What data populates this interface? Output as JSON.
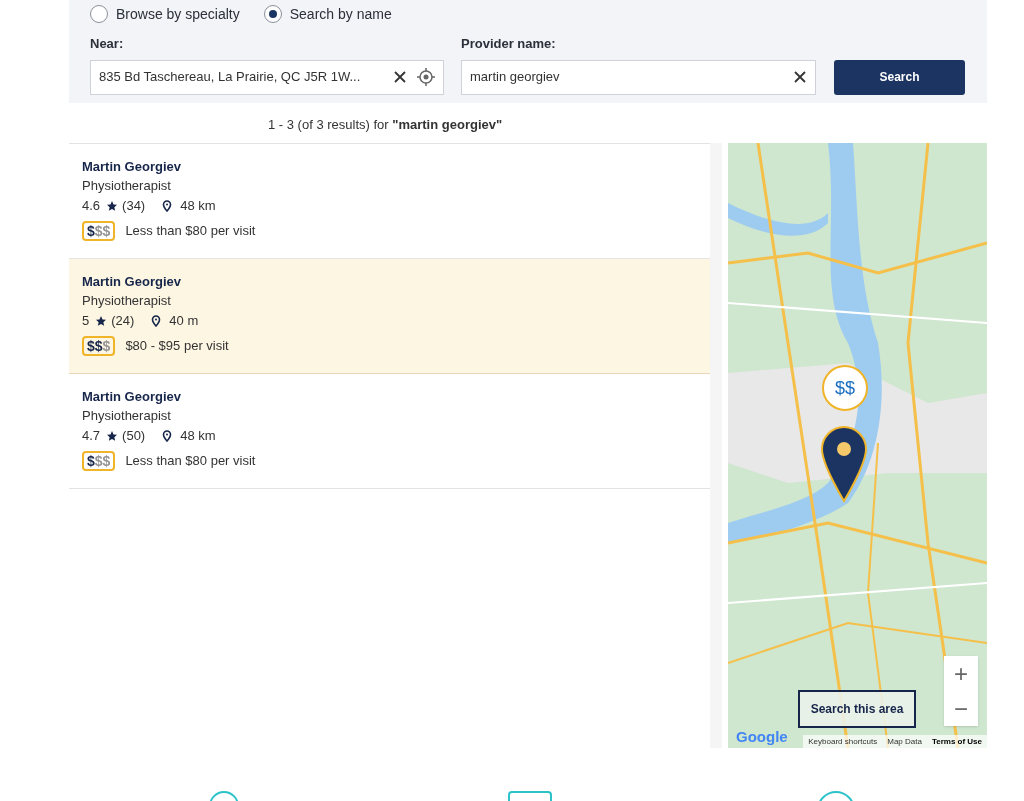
{
  "search_mode": [
    {
      "label": "Browse by specialty",
      "selected": false
    },
    {
      "label": "Search by name",
      "selected": true
    }
  ],
  "near": {
    "label": "Near:",
    "value": "835 Bd Taschereau, La Prairie, QC J5R 1W..."
  },
  "provider": {
    "label": "Provider name:",
    "value": "martin georgiev"
  },
  "search_button": "Search",
  "results_summary": "1 - 3 (of 3 results) for **\"martin georgiev\"**",
  "results": [
    {
      "name": "Martin Georgiev",
      "specialty": "Physiotherapist",
      "rating": "4.6",
      "reviews": "(34)",
      "distance": "48 km",
      "price_filled": "$",
      "price_unfilled": "$$",
      "price_text": "Less than $80 per visit",
      "selected": false
    },
    {
      "name": "Martin Georgiev",
      "specialty": "Physiotherapist",
      "rating": "5",
      "reviews": "(24)",
      "distance": "40 m",
      "price_filled": "$$",
      "price_unfilled": "$",
      "price_text": "$80 - $95 per visit",
      "selected": true
    },
    {
      "name": "Martin Georgiev",
      "specialty": "Physiotherapist",
      "rating": "4.7",
      "reviews": "(50)",
      "distance": "48 km",
      "price_filled": "$",
      "price_unfilled": "$$",
      "price_text": "Less than $80 per visit",
      "selected": false
    }
  ],
  "map": {
    "marker_label": "$$",
    "search_area_button": "Search this area",
    "zoom_in": "+",
    "zoom_out": "−",
    "logo": "Google",
    "footer_links": [
      "Keyboard shortcuts",
      "Map Data",
      "Terms of Use"
    ]
  }
}
